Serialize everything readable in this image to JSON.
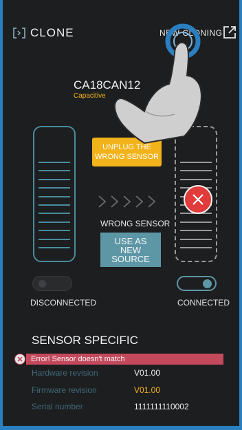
{
  "header": {
    "logo_text": "CLONE",
    "new_cloning_label": "NEW CLONING"
  },
  "sensor": {
    "title": "CA18CAN12",
    "subtitle": "Capacitive"
  },
  "actions": {
    "unplug_line1": "UNPLUG THE",
    "unplug_line2": "WRONG SENSOR",
    "wrong_sensor_label": "WRONG SENSOR",
    "use_line1": "USE AS",
    "use_line2": "NEW",
    "use_line3": "SOURCE"
  },
  "status": {
    "left_label": "DISCONNECTED",
    "right_label": "CONNECTED",
    "left_connected": false,
    "right_connected": true
  },
  "specific": {
    "title": "SENSOR SPECIFIC",
    "error_message": "Error! Sensor doesn't match",
    "rows": [
      {
        "label": "Hardware revision",
        "value": "V01.00",
        "value_color": "#f0f0f0"
      },
      {
        "label": "Firmware revision",
        "value": "V01.00",
        "value_color": "#f2b21a"
      },
      {
        "label": "Serial number",
        "value": "1111111110002",
        "value_color": "#f0f0f0"
      }
    ]
  },
  "icons": [
    "logo-icon",
    "external-link-icon",
    "error-x-icon",
    "chevrons-icon",
    "hand-pointer-icon",
    "tap-ring-icon"
  ],
  "colors": {
    "frame": "#2a7fc0",
    "accent_yellow": "#f2b21a",
    "accent_teal": "#5d97a6",
    "error_red": "#e23b3b",
    "error_bar": "#c4495c"
  }
}
